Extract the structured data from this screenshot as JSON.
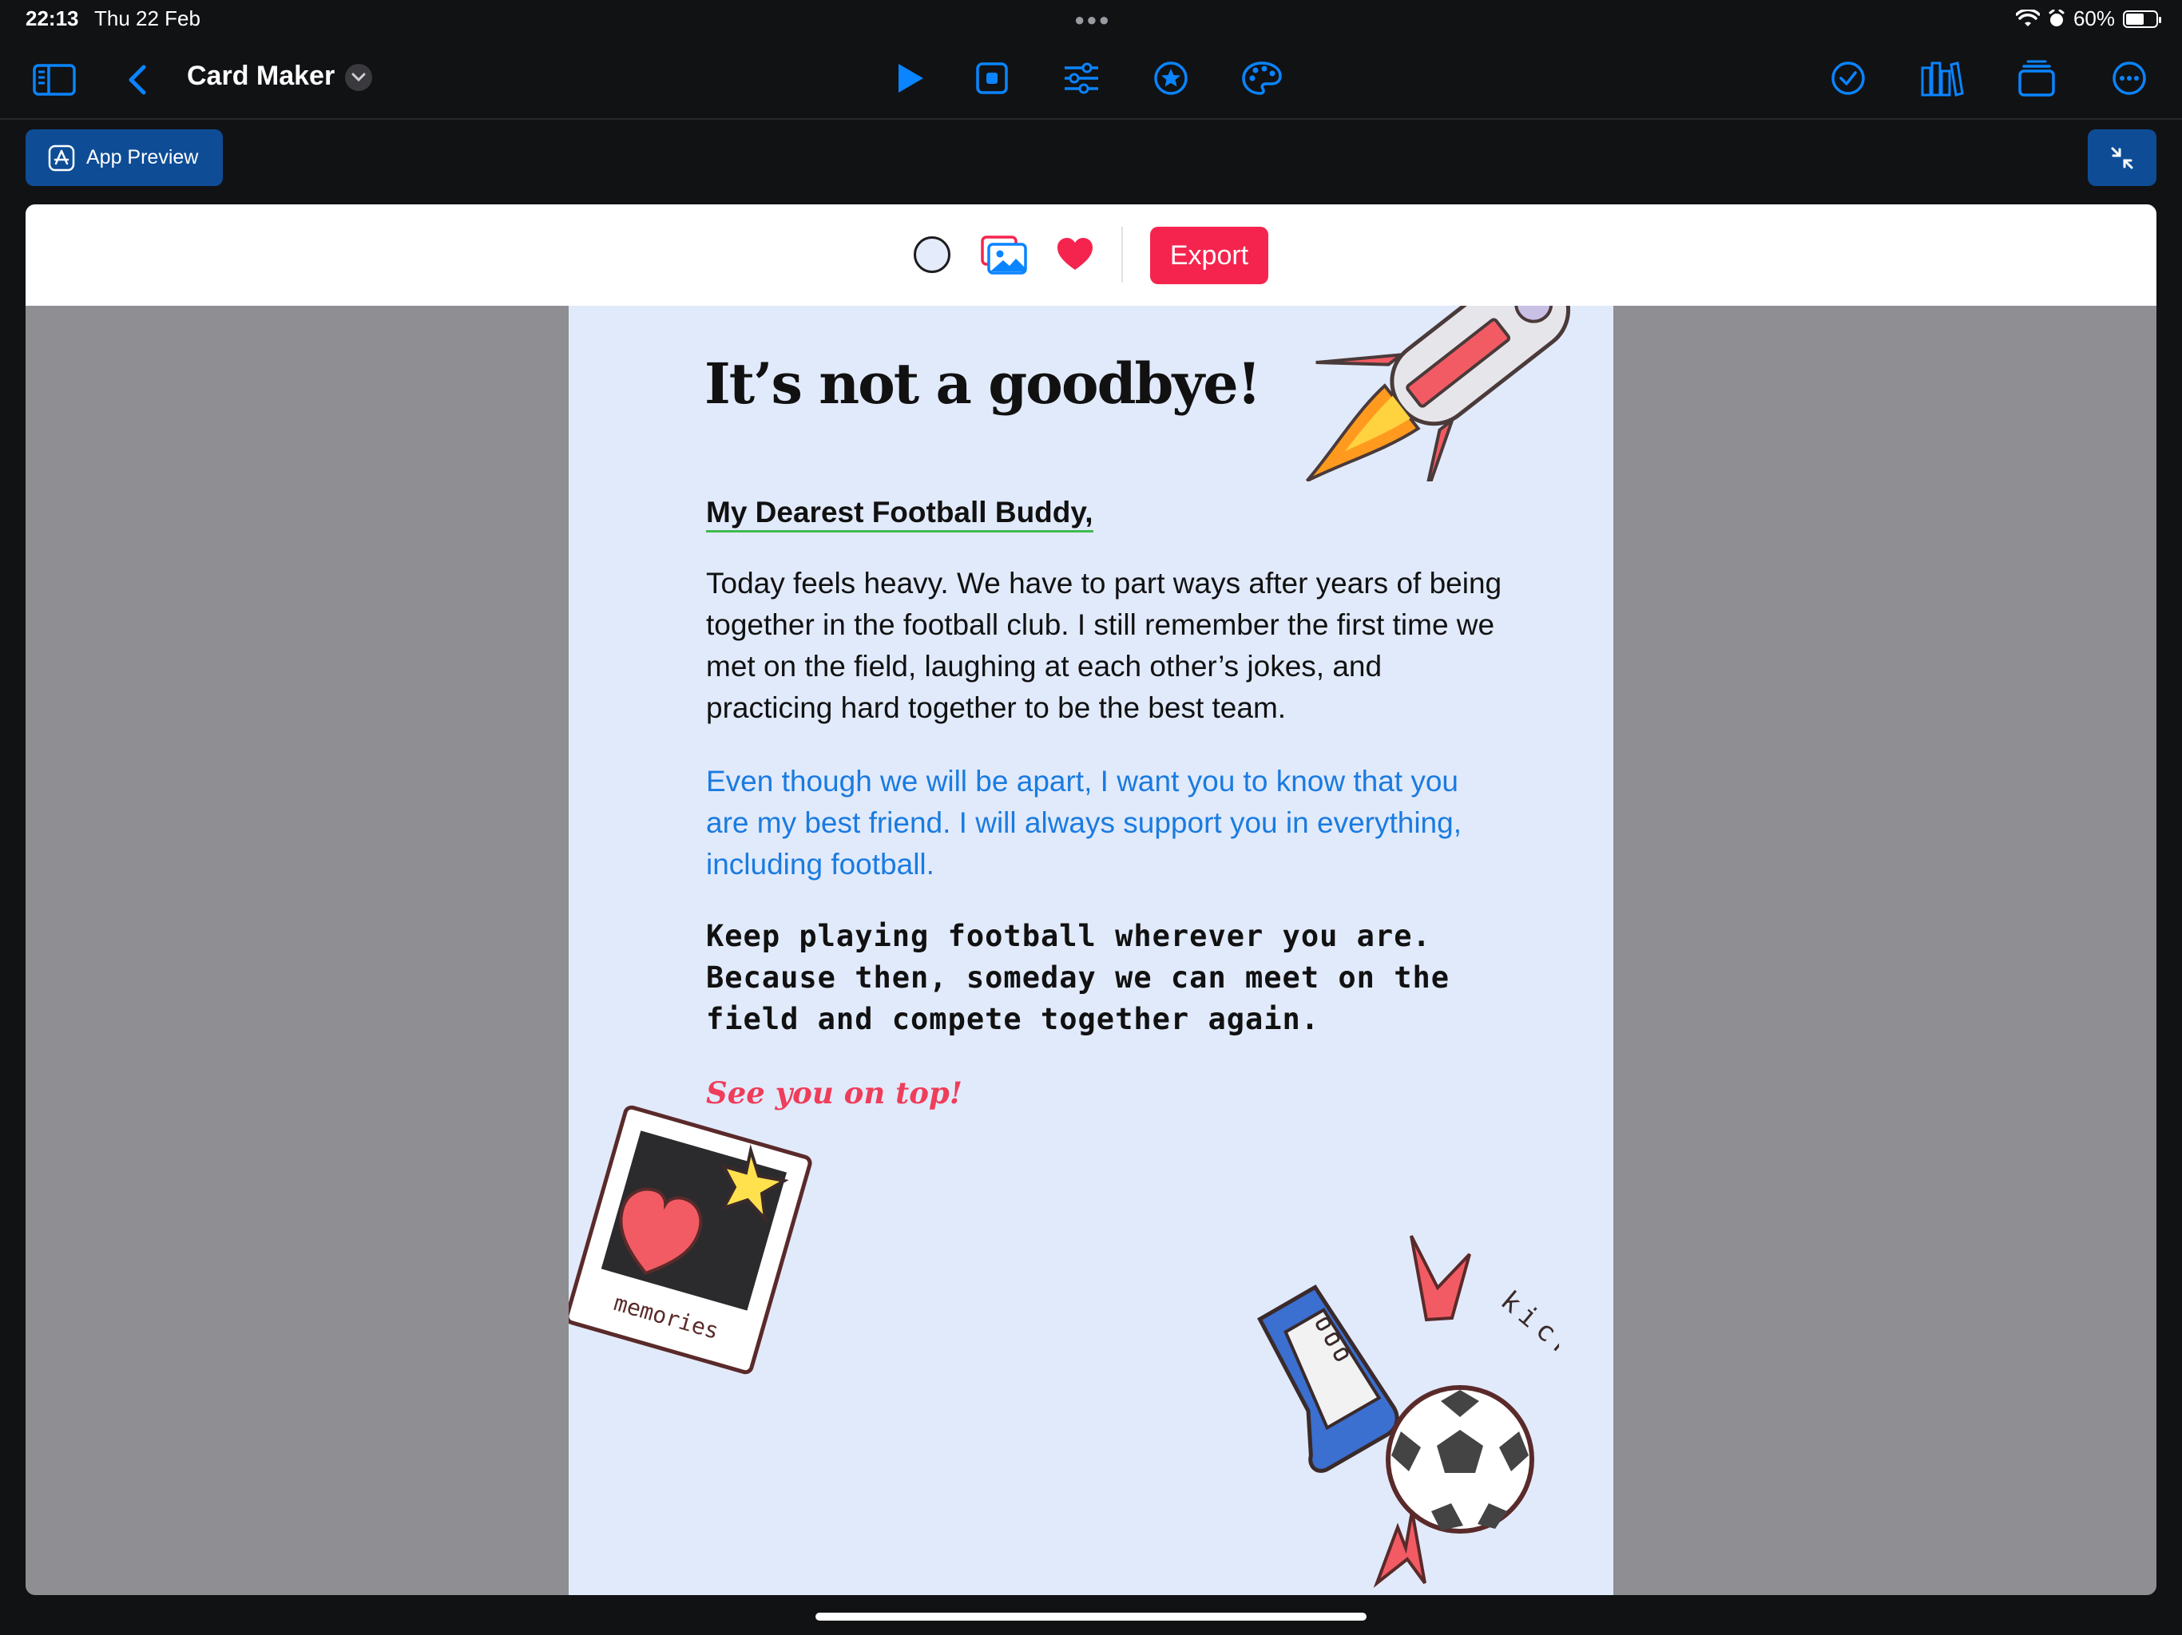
{
  "status_bar": {
    "time": "22:13",
    "date": "Thu 22 Feb",
    "battery": "60%"
  },
  "toolbar": {
    "title": "Card Maker"
  },
  "preview": {
    "label": "App Preview"
  },
  "canvas_toolbar": {
    "export_label": "Export"
  },
  "card": {
    "title": "It’s not a goodbye!",
    "greeting": "My Dearest Football Buddy,",
    "paragraph1": "Today feels heavy. We have to part ways after years of being together in  the football club. I still remember the first time we met on the field, laughing at each other’s jokes, and practicing hard together to be the best team.",
    "paragraph2": "Even though we will be apart, I want you to know that you are my best friend. I will always support you in everything, including football.",
    "paragraph3": "Keep playing football wherever you are. Because then, someday we can meet on the field and compete together again.",
    "signoff": "See you on top!",
    "sticker_memories_text": "memories",
    "sticker_kick_text": "kick it!"
  },
  "colors": {
    "accent": "#0a84ff",
    "export": "#f5244f",
    "card_bg": "#e1eafb",
    "blue_text": "#1a7be0",
    "signoff": "#ef3d5a"
  }
}
